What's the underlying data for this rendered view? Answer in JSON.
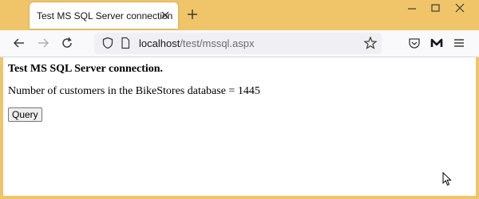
{
  "tab": {
    "title": "Test MS SQL Server connection"
  },
  "address": {
    "host": "localhost",
    "path": "/test/mssql.aspx"
  },
  "page": {
    "heading": "Test MS SQL Server connection.",
    "info": "Number of customers in the BikeStores database = 1445",
    "query_button": "Query"
  },
  "icons": {
    "tab_close": "close-icon",
    "new_tab": "plus-icon",
    "minimize": "minimize-icon",
    "maximize": "maximize-icon",
    "close_window": "close-window-icon",
    "back": "back-arrow-icon",
    "forward": "forward-arrow-icon",
    "reload": "reload-icon",
    "shield": "shield-icon",
    "page": "page-icon",
    "bookmark": "star-icon",
    "pocket": "pocket-icon",
    "account": "m-logo-icon",
    "menu": "hamburger-menu-icon"
  },
  "colors": {
    "frame": "#f0c468",
    "toolbar": "#f9f9fb",
    "urlbar": "#f0f0f4"
  }
}
